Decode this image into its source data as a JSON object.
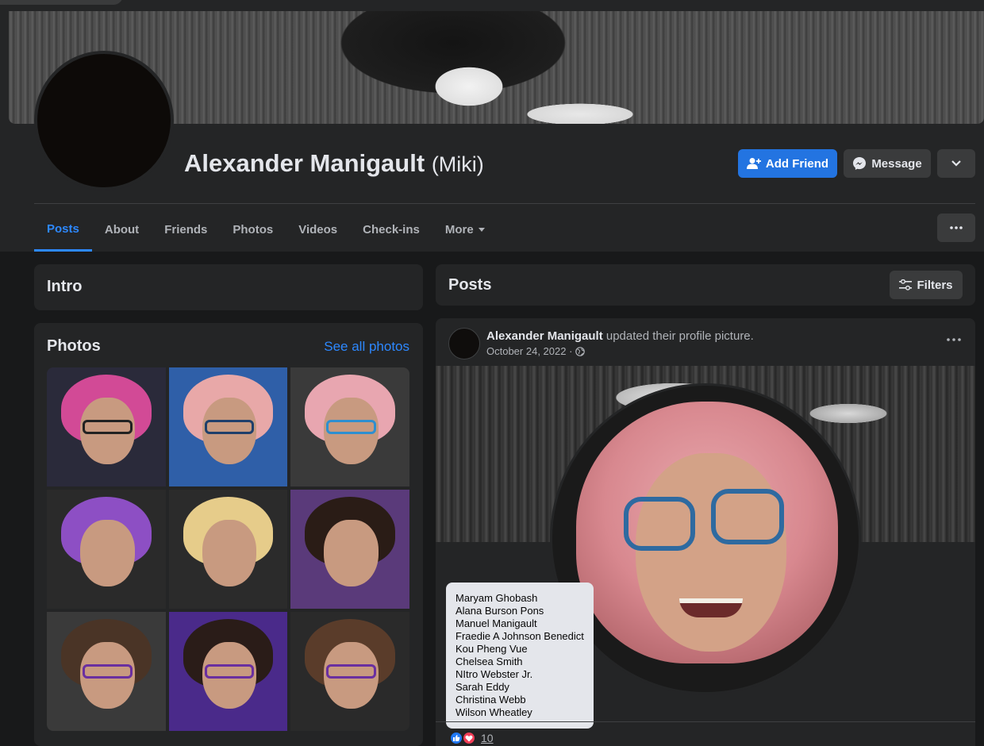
{
  "profile": {
    "name": "Alexander Manigault",
    "alt_name": "(Miki)"
  },
  "actions": {
    "add_friend": "Add Friend",
    "message": "Message"
  },
  "tabs": [
    {
      "label": "Posts"
    },
    {
      "label": "About"
    },
    {
      "label": "Friends"
    },
    {
      "label": "Photos"
    },
    {
      "label": "Videos"
    },
    {
      "label": "Check-ins"
    },
    {
      "label": "More"
    }
  ],
  "intro": {
    "title": "Intro"
  },
  "photos": {
    "title": "Photos",
    "see_all": "See all photos"
  },
  "posts": {
    "title": "Posts",
    "filters": "Filters"
  },
  "post": {
    "author": "Alexander Manigault",
    "action": " updated their profile picture.",
    "date": "October 24, 2022 ·",
    "reaction_count": "10"
  },
  "reactors": [
    "Maryam Ghobash",
    "Alana Burson Pons",
    "Manuel Manigault",
    "Fraedie A Johnson Benedict",
    "Kou Pheng Vue",
    "Chelsea Smith",
    "NItro Webster Jr.",
    "Sarah Eddy",
    "Christina Webb",
    "Wilson Wheatley"
  ],
  "colors": {
    "accent": "#2d88ff",
    "primary_button": "#2374e1",
    "background": "#18191a",
    "surface": "#242526"
  },
  "icons": {
    "add_friend": "person-plus-icon",
    "message": "messenger-icon",
    "more": "chevron-down-icon",
    "options": "ellipsis-icon",
    "filters": "sliders-icon",
    "privacy": "globe-icon",
    "like": "like-icon",
    "love": "heart-icon"
  }
}
